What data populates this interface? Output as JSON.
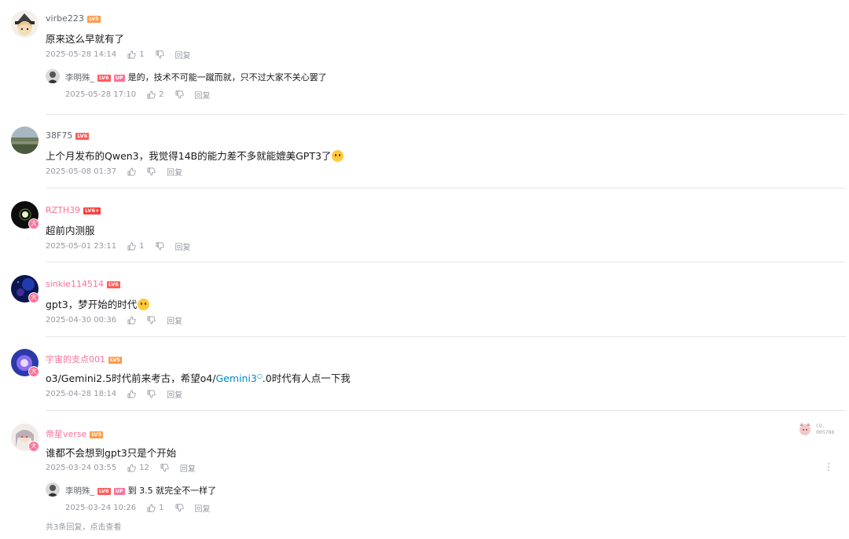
{
  "comments": [
    {
      "user": "virbe223",
      "level": "LV5",
      "text": "原来这么早就有了",
      "time": "2025-05-28 14:14",
      "likes": "1",
      "reply_label": "回复",
      "reply": {
        "user": "李明殊_",
        "level": "LV6",
        "up_badge": "UP",
        "text": "是的，技术不可能一蹴而就，只不过大家不关心罢了",
        "time": "2025-05-28 17:10",
        "likes": "2",
        "reply_label": "回复"
      }
    },
    {
      "user": "38F75",
      "level": "LV6",
      "text": "上个月发布的Qwen3，我觉得14B的能力差不多就能媲美GPT3了",
      "time": "2025-05-08 01:37",
      "likes": "",
      "reply_label": "回复"
    },
    {
      "user": "RZTH39",
      "level": "LV6+",
      "text": "超前内测服",
      "time": "2025-05-01 23:11",
      "likes": "1",
      "reply_label": "回复"
    },
    {
      "user": "sinkie114514",
      "level": "LV6",
      "text": "gpt3，梦开始的时代",
      "time": "2025-04-30 00:36",
      "likes": "",
      "reply_label": "回复"
    },
    {
      "user": "宇宙的支点001",
      "level": "LV5",
      "text_before": "o3/Gemini2.5时代前来考古，希望o4/",
      "text_link": "Gemini3",
      "text_after": ".0时代有人点一下我",
      "time": "2025-04-28 18:14",
      "likes": "",
      "reply_label": "回复"
    },
    {
      "user": "帝星verse",
      "level": "LV5",
      "text": "谁都不会想到gpt3只是个开始",
      "time": "2025-03-24 03:55",
      "likes": "12",
      "reply_label": "回复",
      "reply": {
        "user": "李明殊_",
        "level": "LV6",
        "up_badge": "UP",
        "text": "到 3.5 就完全不一样了",
        "time": "2025-03-24 10:26",
        "likes": "1",
        "reply_label": "回复"
      },
      "view_more": "共3条回复，点击查看"
    }
  ],
  "stamp": {
    "line1": "CO.",
    "line2": "005786"
  },
  "more_icon": "⋮",
  "vip_badge_glyph": "大",
  "colors": {
    "pink": "#fb7299",
    "link": "#008ac5",
    "meta": "#9499a0"
  }
}
